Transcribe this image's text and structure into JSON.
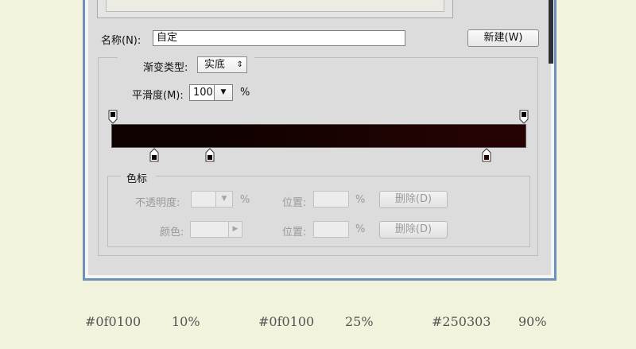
{
  "dialog": {
    "name_label": "名称(N):",
    "name_value": "自定",
    "new_button": "新建(W)",
    "gradient_type_label": "渐变类型:",
    "gradient_type_value": "实底",
    "smoothness_label": "平滑度(M):",
    "smoothness_value": "100",
    "smoothness_unit": "%",
    "colors": {
      "accent_frame": "#6d8fb9",
      "gradient_start": "#0f0100",
      "gradient_end": "#250303"
    },
    "stops_section": {
      "title": "色标",
      "opacity_label": "不透明度:",
      "opacity_unit": "%",
      "location_label_1": "位置:",
      "location_unit_1": "%",
      "delete_button_1": "删除(D)",
      "color_label": "颜色:",
      "location_label_2": "位置:",
      "location_unit_2": "%",
      "delete_button_2": "删除(D)"
    }
  },
  "annotations": [
    {
      "color": "#0f0100",
      "position": "10%"
    },
    {
      "color": "#0f0100",
      "position": "25%"
    },
    {
      "color": "#250303",
      "position": "90%"
    }
  ]
}
